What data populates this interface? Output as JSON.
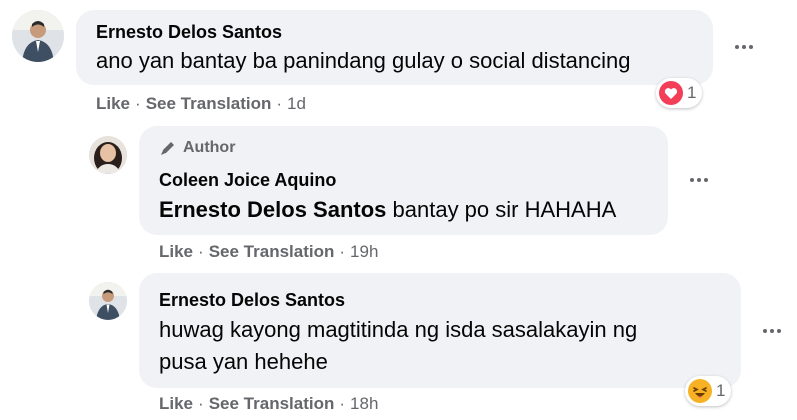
{
  "comments": [
    {
      "author": "Ernesto Delos Santos",
      "text": "ano yan bantay ba panindang gulay o social distancing",
      "actions": {
        "like": "Like",
        "see_translation": "See Translation",
        "time": "1d"
      },
      "reaction": {
        "type": "love-icon",
        "count": "1"
      }
    },
    {
      "badge": "Author",
      "author": "Coleen Joice Aquino",
      "mention": "Ernesto Delos Santos",
      "text": "bantay po sir HAHAHA",
      "actions": {
        "like": "Like",
        "see_translation": "See Translation",
        "time": "19h"
      }
    },
    {
      "author": "Ernesto Delos Santos",
      "text_line1": "huwag kayong magtitinda ng isda sasalakayin ng",
      "text_line2": "pusa yan hehehe",
      "actions": {
        "like": "Like",
        "see_translation": "See Translation",
        "time": "18h"
      },
      "reaction": {
        "type": "haha-icon",
        "count": "1"
      }
    }
  ],
  "separator": "·",
  "colors": {
    "bubble": "#f0f2f5",
    "secondary_text": "#65676b",
    "love": "#f33e58",
    "haha": "#f7b125"
  }
}
